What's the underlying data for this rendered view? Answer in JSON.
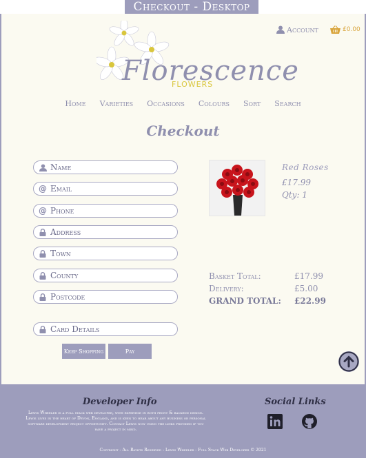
{
  "banner": {
    "title": "Checkout - Desktop"
  },
  "header": {
    "logo_text": "Florescence",
    "logo_sub": "FLOWERS",
    "account_label": "Account",
    "cart_total": "£0.00"
  },
  "nav": {
    "items": [
      "Home",
      "Varieties",
      "Occasions",
      "Colours",
      "Sort",
      "Search"
    ]
  },
  "page_title": "Checkout",
  "form": {
    "fields": [
      {
        "placeholder": "Name",
        "icon": "user-icon"
      },
      {
        "placeholder": "Email",
        "icon": "at-icon"
      },
      {
        "placeholder": "Phone",
        "icon": "at-icon"
      },
      {
        "placeholder": "Address",
        "icon": "lock-icon"
      },
      {
        "placeholder": "Town",
        "icon": "lock-icon"
      },
      {
        "placeholder": "County",
        "icon": "lock-icon"
      },
      {
        "placeholder": "Postcode",
        "icon": "lock-icon"
      },
      {
        "placeholder": "Card Details",
        "icon": "lock-icon"
      }
    ],
    "keep_shopping_label": "Keep Shopping",
    "pay_label": "Pay"
  },
  "product": {
    "name": "Red Roses",
    "price": "£17.99",
    "qty": "Qty: 1"
  },
  "summary": {
    "basket_label": "Basket Total:",
    "basket_value": "£17.99",
    "delivery_label": "Delivery:",
    "delivery_value": "£5.00",
    "grand_label": "GRAND TOTAL:",
    "grand_value": "£22.99"
  },
  "footer": {
    "dev_title": "Developer Info",
    "dev_text": "Lewis Wheeler is a full stack web developer, with expertise in both front & backend design. Lewis lives in the heart of Devon, England, and is keen to hear about any business or personal software development project opportunity. Contact Lewis now using the links provided if you have a project in mind.",
    "social_title": "Social Links",
    "copyright": "Copyright - All Rights Reserved - Lewis Wheeler - Full Stack Web Developer © 2021"
  },
  "colors": {
    "accent": "#9d9dbc",
    "background": "#fbfaf1",
    "gold": "#d9c63d",
    "rose": "#d8262c"
  }
}
